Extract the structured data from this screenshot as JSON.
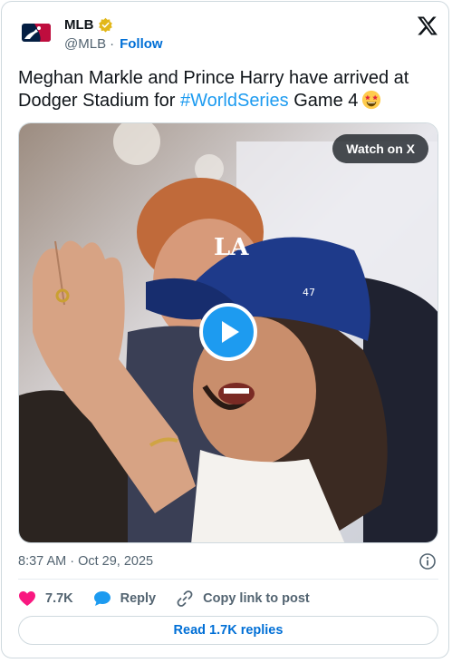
{
  "account": {
    "display_name": "MLB",
    "handle": "@MLB",
    "separator": "·",
    "follow_label": "Follow",
    "verified": true
  },
  "tweet": {
    "text_before": "Meghan Markle and Prince Harry have arrived at Dodger Stadium for ",
    "hashtag": "#WorldSeries",
    "text_after": " Game 4",
    "emoji": "star-struck"
  },
  "media": {
    "watch_label": "Watch on X",
    "play_icon": "play-icon",
    "cap_logo": "LA",
    "cap_side_logo": "47"
  },
  "meta": {
    "timestamp": "8:37 AM · Oct 29, 2025"
  },
  "actions": {
    "likes": "7.7K",
    "reply_label": "Reply",
    "copy_link_label": "Copy link to post"
  },
  "footer": {
    "read_replies_label": "Read 1.7K replies"
  },
  "colors": {
    "accent": "#1d9bf0",
    "link": "#006fd6",
    "like": "#f91880",
    "verified": "#e2b719"
  }
}
